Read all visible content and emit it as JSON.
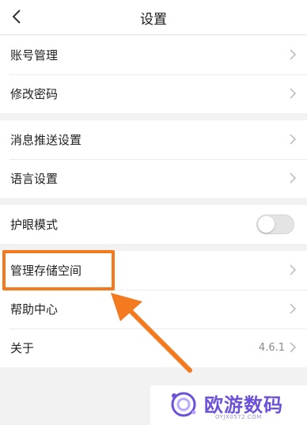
{
  "header": {
    "title": "设置"
  },
  "groups": [
    {
      "items": [
        {
          "label": "账号管理"
        },
        {
          "label": "修改密码"
        }
      ]
    },
    {
      "items": [
        {
          "label": "消息推送设置"
        },
        {
          "label": "语言设置"
        }
      ]
    },
    {
      "items": [
        {
          "label": "护眼模式",
          "toggle_on": false
        }
      ]
    },
    {
      "items": [
        {
          "label": "管理存储空间"
        },
        {
          "label": "帮助中心"
        },
        {
          "label": "关于",
          "value": "4.6.1"
        }
      ]
    }
  ],
  "annotation": {
    "highlight_color": "#f47a20"
  },
  "watermark": {
    "brand": "欧游数码",
    "site": "OYJX0572.COM",
    "color": "#6d52d8"
  },
  "icons": {
    "back": "chevron-left-icon",
    "row_arrow": "chevron-right-icon"
  }
}
